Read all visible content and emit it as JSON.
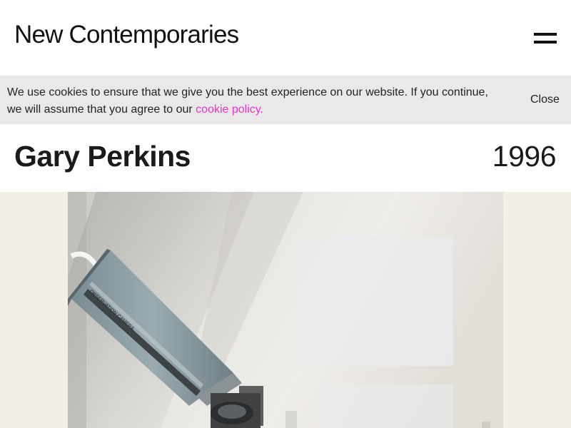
{
  "header": {
    "logo_text": "New Contemporaries",
    "menu_icon": "hamburger-icon"
  },
  "cookie_banner": {
    "message": "We use cookies to ensure that we give you the best experience on our website. If you continue, we will assume that you agree to our ",
    "link_text": "cookie policy.",
    "close_label": "Close",
    "link_color": "#ee33c8",
    "background": "#e9e9e9"
  },
  "artist": {
    "name": "Gary Perkins",
    "year": "1996"
  },
  "artwork": {
    "camera_label": "OBSERVATION CAMERA"
  }
}
